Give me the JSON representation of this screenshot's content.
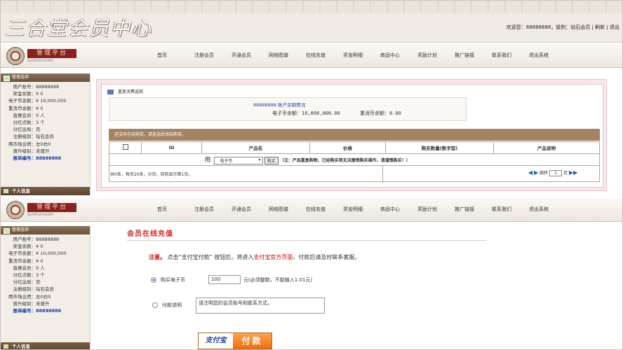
{
  "header": {
    "title": "三合堂会员中心",
    "welcome": "欢迎您：88888888，级别：钻石会员 | 刷新 | 退出"
  },
  "logo": {
    "text": "管理平台",
    "sub": "QUANTUM EVENTS"
  },
  "nav": [
    "首页",
    "注册会员",
    "开通会员",
    "网络图谱",
    "在线充值",
    "奖金明细",
    "商品中心",
    "奖励计划",
    "推广链接",
    "联系我们",
    "退出系统"
  ],
  "sidebar": {
    "title": "管理选项",
    "rows": [
      {
        "label": "用户账号：",
        "value": "88888888"
      },
      {
        "label": "奖金余额：",
        "value": "¥ 0"
      },
      {
        "label": "电子币余额：",
        "value": "¥ 10,000,000"
      },
      {
        "label": "重消币余额：",
        "value": "¥ 0"
      },
      {
        "label": "直推会员：",
        "value": "0 人"
      },
      {
        "label": "分红点数：",
        "value": "3 个"
      },
      {
        "label": "分红出局：",
        "value": "否"
      },
      {
        "label": "注册级别：",
        "value": "钻石会员"
      },
      {
        "label": "两市场业绩：",
        "value": "左0右0"
      },
      {
        "label": "晋升级别：",
        "value": "未晋升"
      },
      {
        "label": "报单编号：",
        "value": "88888888"
      }
    ],
    "footer": "个人信息"
  },
  "panel": {
    "title": "重复消费选购",
    "acct_title": "88888888 账户余额情况",
    "bal1": "电子币余额：10,000,000.00",
    "bal2": "重消币余额：0.00",
    "notice": "还没有在线购货，请查选后添加购货。",
    "cols": [
      "ID",
      "产品名",
      "价格",
      "购买数量(数字型)",
      "产品说明"
    ],
    "use_label": "用",
    "currency": "电子币",
    "buy_btn": "购买",
    "buy_note": "（注：产品重复购物，已经购买将无法撤销购买操作，请谨慎购买！）",
    "pager_info": "共0条，每页20条，分页，目前显示第1页。",
    "pager_go": "跳转",
    "pager_page": "1",
    "pager_unit": "页"
  },
  "recharge": {
    "title": "会员在线充值",
    "note_prefix": "注意。",
    "note_text1": "点击“支付宝付款” 按钮后，将进入",
    "note_link": "支付宝官方页面",
    "note_text2": "，付款后请及时联系客服。",
    "buy_label": "购买电子币",
    "amount": "100",
    "amount_hint": "元(必须整数，不能输入1.01元)",
    "desc_label": "付款说明",
    "desc_value": "请注明您的会员账号和联系方式。",
    "pay_brand": "支付宝",
    "pay_label": "付款"
  }
}
